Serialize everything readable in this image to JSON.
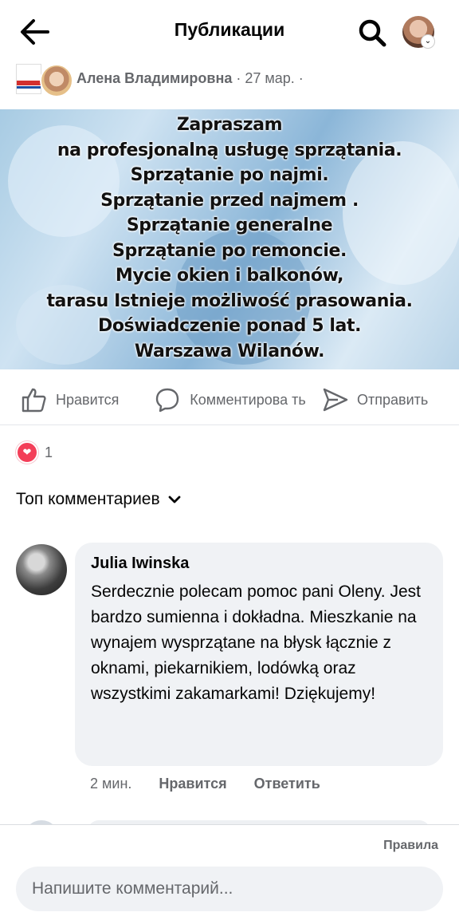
{
  "topbar": {
    "title": "Публикации",
    "back_icon": "arrow-left-icon",
    "search_icon": "search-icon"
  },
  "post": {
    "author": "Алена Владимировна",
    "meta": " · 27 мар. ·",
    "image_text": [
      "Zapraszam",
      "na profesjonalną usługę sprzątania.",
      "Sprzątanie po najmi.",
      "Sprzątanie przed najmem .",
      "Sprzątanie generalne",
      "Sprzątanie po remoncie.",
      "Mycie okien i balkonów,",
      "tarasu Istnieje możliwość prasowania.",
      "Doświadczenie ponad 5 lat.",
      "Warszawa Wilanów."
    ]
  },
  "actions": {
    "like": "Нравится",
    "comment": "Комментирова ть",
    "share": "Отправить"
  },
  "reactions": {
    "count": "1"
  },
  "comments_sort": "Топ комментариев",
  "comment": {
    "author": "Julia Iwinska",
    "text": "Serdecznie polecam pomoc pani Oleny. Jest bardzo sumienna i dokładna. Mieszkanie na wynajem wysprzątane na błysk łącznie z oknami, piekarnikiem, lodówką oraz wszystkimi zakamarkami! Dziękujemy!",
    "time": "2 мин.",
    "like": "Нравится",
    "reply": "Ответить"
  },
  "footer": {
    "rules": "Правила",
    "input_placeholder": "Напишите комментарий..."
  },
  "colors": {
    "heart": "#f33e58",
    "secondary_text": "#65676b",
    "bubble": "#f0f2f5"
  }
}
